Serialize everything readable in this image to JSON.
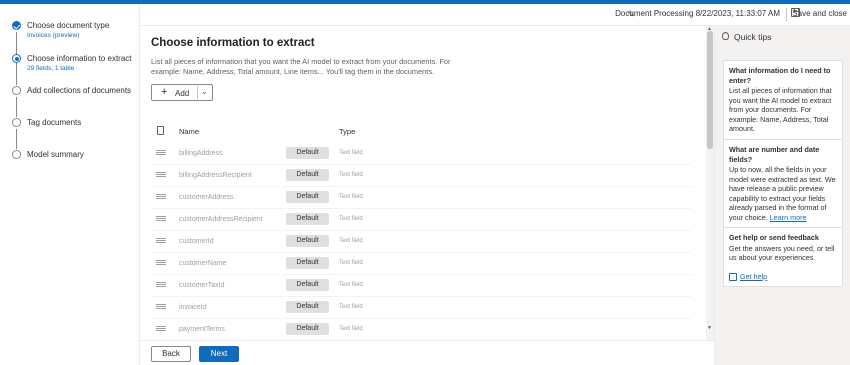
{
  "header": {
    "doc_title": "Document Processing 8/22/2023, 11:33:07 AM",
    "save_label": "Save and close"
  },
  "stepper": {
    "steps": [
      {
        "label": "Choose document type",
        "sub": "Invoices (preview)",
        "state": "done"
      },
      {
        "label": "Choose information to extract",
        "sub": "29 fields, 1 table",
        "state": "current"
      },
      {
        "label": "Add collections of documents",
        "sub": "",
        "state": "todo"
      },
      {
        "label": "Tag documents",
        "sub": "",
        "state": "todo"
      },
      {
        "label": "Model summary",
        "sub": "",
        "state": "todo"
      }
    ]
  },
  "main": {
    "title": "Choose information to extract",
    "description": "List all pieces of information that you want the AI model to extract from your documents. For example: Name, Address, Total amount, Line items... You'll tag them in the documents.",
    "add_label": "Add",
    "columns": {
      "name": "Name",
      "type": "Type"
    },
    "rows": [
      {
        "name": "billingAddress",
        "badge": "Default",
        "type": "Text field"
      },
      {
        "name": "billingAddressRecipient",
        "badge": "Default",
        "type": "Text field"
      },
      {
        "name": "customerAddress",
        "badge": "Default",
        "type": "Text field"
      },
      {
        "name": "customerAddressRecipient",
        "badge": "Default",
        "type": "Text field"
      },
      {
        "name": "customerId",
        "badge": "Default",
        "type": "Text field"
      },
      {
        "name": "customerName",
        "badge": "Default",
        "type": "Text field"
      },
      {
        "name": "customerTaxId",
        "badge": "Default",
        "type": "Text field"
      },
      {
        "name": "invoiceId",
        "badge": "Default",
        "type": "Text field"
      },
      {
        "name": "paymentTerms",
        "badge": "Default",
        "type": "Text field"
      }
    ]
  },
  "footer": {
    "back_label": "Back",
    "next_label": "Next"
  },
  "tips": {
    "title": "Quick tips",
    "cards": [
      {
        "title": "What information do I need to enter?",
        "body": "List all pieces of information that you want the AI model to extract from your documents. For example: Name, Address, Total amount."
      },
      {
        "title": "What are number and date fields?",
        "body": "Up to now, all the fields in your model were extracted as text. We have release a public preview capability to extract your fields already parsed in the format of your choice.",
        "link": "Learn more"
      },
      {
        "title": "Get help or send feedback",
        "body": "Get the answers you need, or tell us about your experiences.",
        "help": "Get help"
      }
    ]
  },
  "colors": {
    "accent": "#0f6cbd",
    "badge": "#e1dfdd",
    "panel": "#f3f2f1"
  }
}
